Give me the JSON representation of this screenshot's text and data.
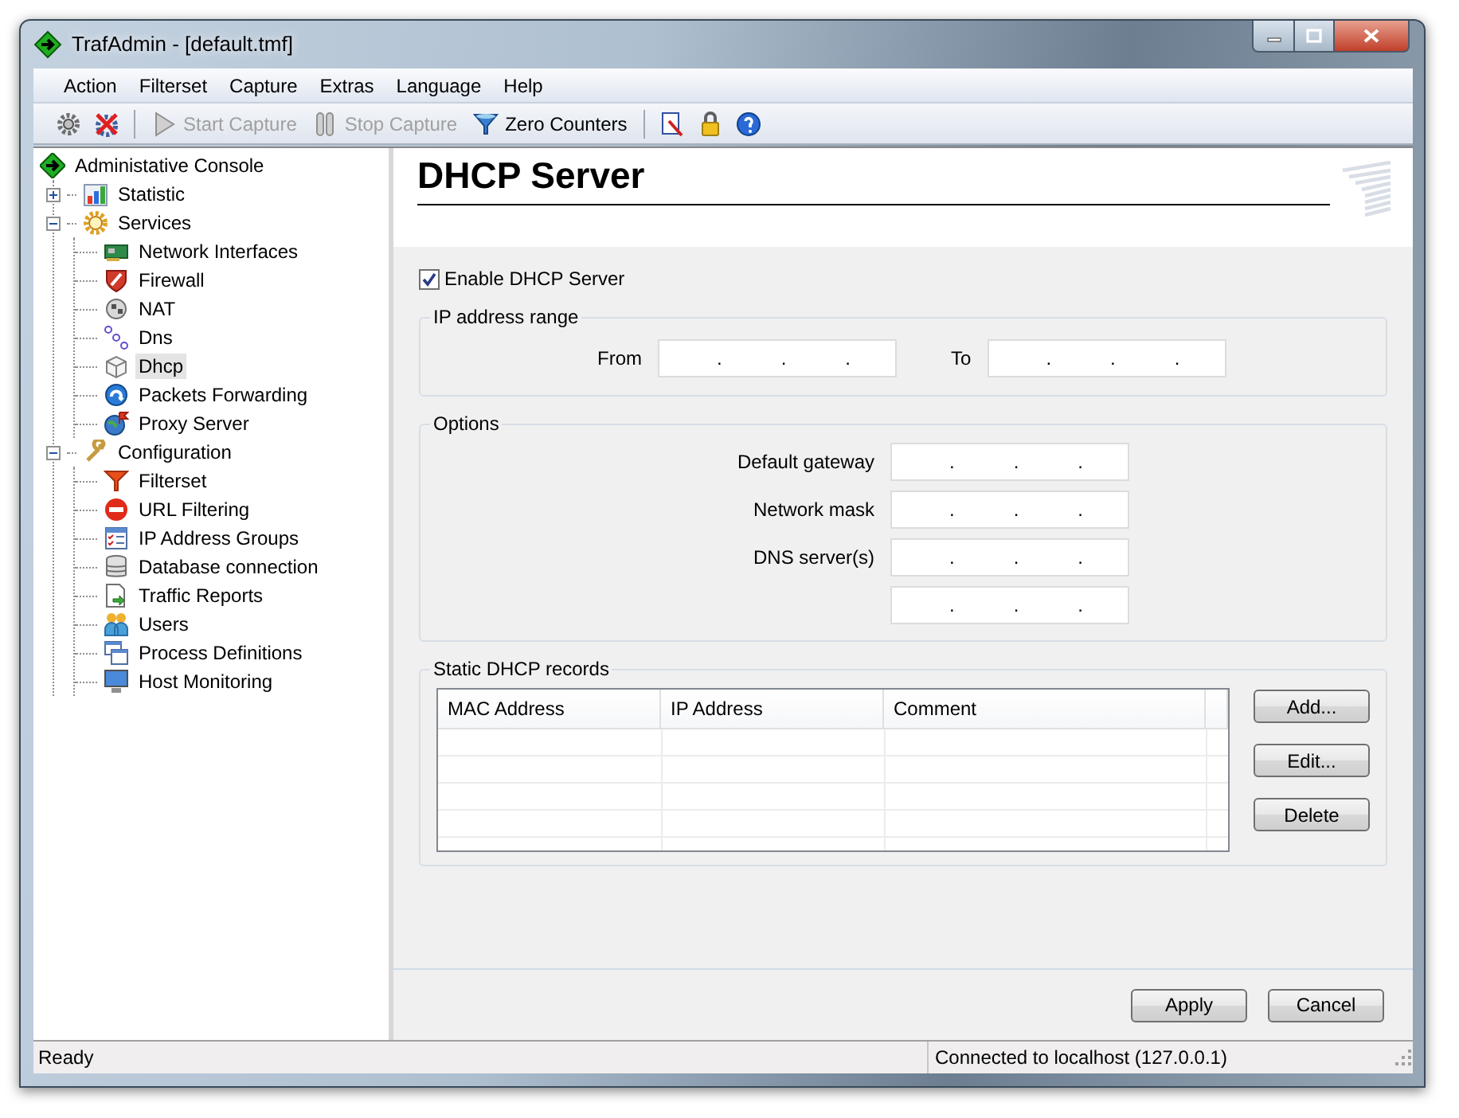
{
  "window": {
    "title": "TrafAdmin - [default.tmf]"
  },
  "menu": [
    "Action",
    "Filterset",
    "Capture",
    "Extras",
    "Language",
    "Help"
  ],
  "toolbar": [
    {
      "label": "Start Capture",
      "disabled": true
    },
    {
      "label": "Stop Capture",
      "disabled": true
    },
    {
      "label": "Zero Counters",
      "disabled": false
    }
  ],
  "tree": [
    {
      "label": "Administative Console",
      "selected": false,
      "children": [
        {
          "label": "Statistic",
          "selected": false,
          "expanded": false
        },
        {
          "label": "Services",
          "selected": false,
          "expanded": true,
          "children": [
            {
              "label": "Network Interfaces",
              "selected": false
            },
            {
              "label": "Firewall",
              "selected": false
            },
            {
              "label": "NAT",
              "selected": false
            },
            {
              "label": "Dns",
              "selected": false
            },
            {
              "label": "Dhcp",
              "selected": true
            },
            {
              "label": "Packets Forwarding",
              "selected": false
            },
            {
              "label": "Proxy Server",
              "selected": false
            }
          ]
        },
        {
          "label": "Configuration",
          "selected": false,
          "expanded": true,
          "children": [
            {
              "label": "Filterset",
              "selected": false
            },
            {
              "label": "URL Filtering",
              "selected": false
            },
            {
              "label": "IP Address Groups",
              "selected": false
            },
            {
              "label": "Database connection",
              "selected": false
            },
            {
              "label": "Traffic Reports",
              "selected": false
            },
            {
              "label": "Users",
              "selected": false
            },
            {
              "label": "Process Definitions",
              "selected": false
            },
            {
              "label": "Host Monitoring",
              "selected": false
            }
          ]
        }
      ]
    }
  ],
  "panel": {
    "title": "DHCP Server",
    "enable": {
      "label": "Enable DHCP Server",
      "checked": true
    },
    "range": {
      "title": "IP address range",
      "fields": [
        {
          "label": "From",
          "separators": [
            ".",
            ".",
            "."
          ]
        },
        {
          "label": "To",
          "separators": [
            ".",
            ".",
            "."
          ]
        }
      ]
    },
    "options": {
      "title": "Options",
      "rows": [
        {
          "label": "Default gateway",
          "separators": [
            ".",
            ".",
            "."
          ]
        },
        {
          "label": "Network mask",
          "separators": [
            ".",
            ".",
            "."
          ]
        },
        {
          "label": "DNS server(s)",
          "separators": [
            ".",
            ".",
            "."
          ]
        },
        {
          "separators": [
            ".",
            ".",
            "."
          ]
        }
      ]
    },
    "records": {
      "title": "Static DHCP records",
      "columns": [
        "MAC Address",
        "IP Address",
        "Comment"
      ],
      "buttons": [
        "Add...",
        "Edit...",
        "Delete"
      ]
    },
    "footer_buttons": [
      "Apply",
      "Cancel"
    ]
  },
  "status_bar": {
    "message": "Ready",
    "connection": "Connected to localhost (127.0.0.1)"
  }
}
